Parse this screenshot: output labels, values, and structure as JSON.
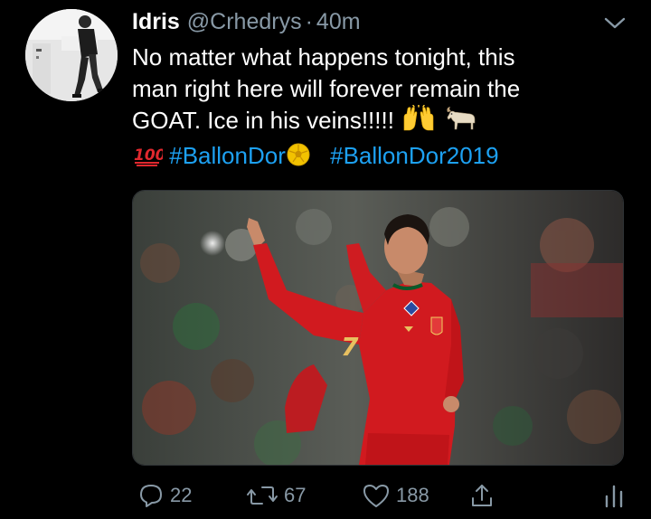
{
  "tweet": {
    "display_name": "Idris",
    "handle": "@Crhedrys",
    "separator": "·",
    "time": "40m",
    "text_lines": [
      "No matter what happens tonight, this",
      "man right here will forever remain the",
      "GOAT. Ice in his veins!!!!!"
    ],
    "hashtags": [
      "#BallonDor",
      "#BallonDor2019"
    ],
    "emojis": [
      "raising-hands",
      "goat",
      "hundred-points",
      "soccer-ball"
    ],
    "media": {
      "jersey_number": "7",
      "description_icon": "football-player-photo"
    }
  },
  "actions": {
    "replies": "22",
    "retweets": "67",
    "likes": "188"
  },
  "colors": {
    "background": "#000000",
    "secondary_text": "#8899a6",
    "link": "#1da1f2",
    "jersey_red": "#d11a1f"
  }
}
